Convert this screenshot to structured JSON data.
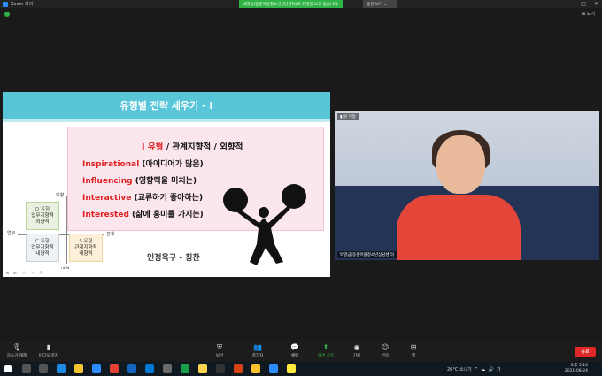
{
  "window": {
    "title": "Zoom 회의"
  },
  "share_banner": {
    "text": "박영금(동준어울청소년상담센터)의 화면을 보고 있습니다.",
    "options_label": "옵션 보기 ⌄"
  },
  "view_button": "⊞ 보기",
  "slide": {
    "title": "유형별 전략 세우기 - I",
    "type_line": {
      "red": "I 유형",
      "rest": " / 관계지향적 / 외향적"
    },
    "lines": [
      {
        "red": "Inspirational",
        "rest": " (아이디어가 많은)"
      },
      {
        "red": "Influencing",
        "rest": " (영향력을 미치는)"
      },
      {
        "red": "Interactive",
        "rest": " (교류하기 좋아하는)"
      },
      {
        "red": "Interested",
        "rest": " (삶에 흥미를 가지는)"
      }
    ],
    "axis": {
      "top": "외향",
      "bottom": "내향",
      "left": "업무",
      "right": "관계"
    },
    "quadrants": {
      "d": {
        "head": "D 유형",
        "body1": "업무지향적",
        "body2": "외향적"
      },
      "c": {
        "head": "C 유형",
        "body1": "업무지향적",
        "body2": "내향적"
      },
      "s": {
        "head": "S 유형",
        "body1": "관계지향적",
        "body2": "내향적"
      }
    },
    "recognition": "인정욕구 - 칭찬"
  },
  "video": {
    "tag": "▮ 원 계정",
    "name": "박영금(동준어울청소년상담센터)"
  },
  "toolbar": {
    "items": [
      {
        "label": "음소거 해제",
        "icon": "mic-off-icon"
      },
      {
        "label": "비디오 중지",
        "icon": "video-icon"
      },
      {
        "label": "보안",
        "icon": "shield-icon"
      },
      {
        "label": "참가자",
        "icon": "participants-icon",
        "count": "60"
      },
      {
        "label": "채팅",
        "icon": "chat-icon"
      },
      {
        "label": "화면 공유",
        "icon": "share-screen-icon"
      },
      {
        "label": "기록",
        "icon": "record-icon"
      },
      {
        "label": "반응",
        "icon": "reaction-icon"
      },
      {
        "label": "앱",
        "icon": "apps-icon"
      }
    ],
    "end_label": "종료"
  },
  "taskbar": {
    "weather": "26°C 소나기",
    "time": "오후 5:10",
    "date": "2021-08-24",
    "ime": "가"
  },
  "colors": {
    "accent": "#58c6d8",
    "red": "#e02020",
    "end": "#e02828",
    "banner": "#2fb344"
  }
}
